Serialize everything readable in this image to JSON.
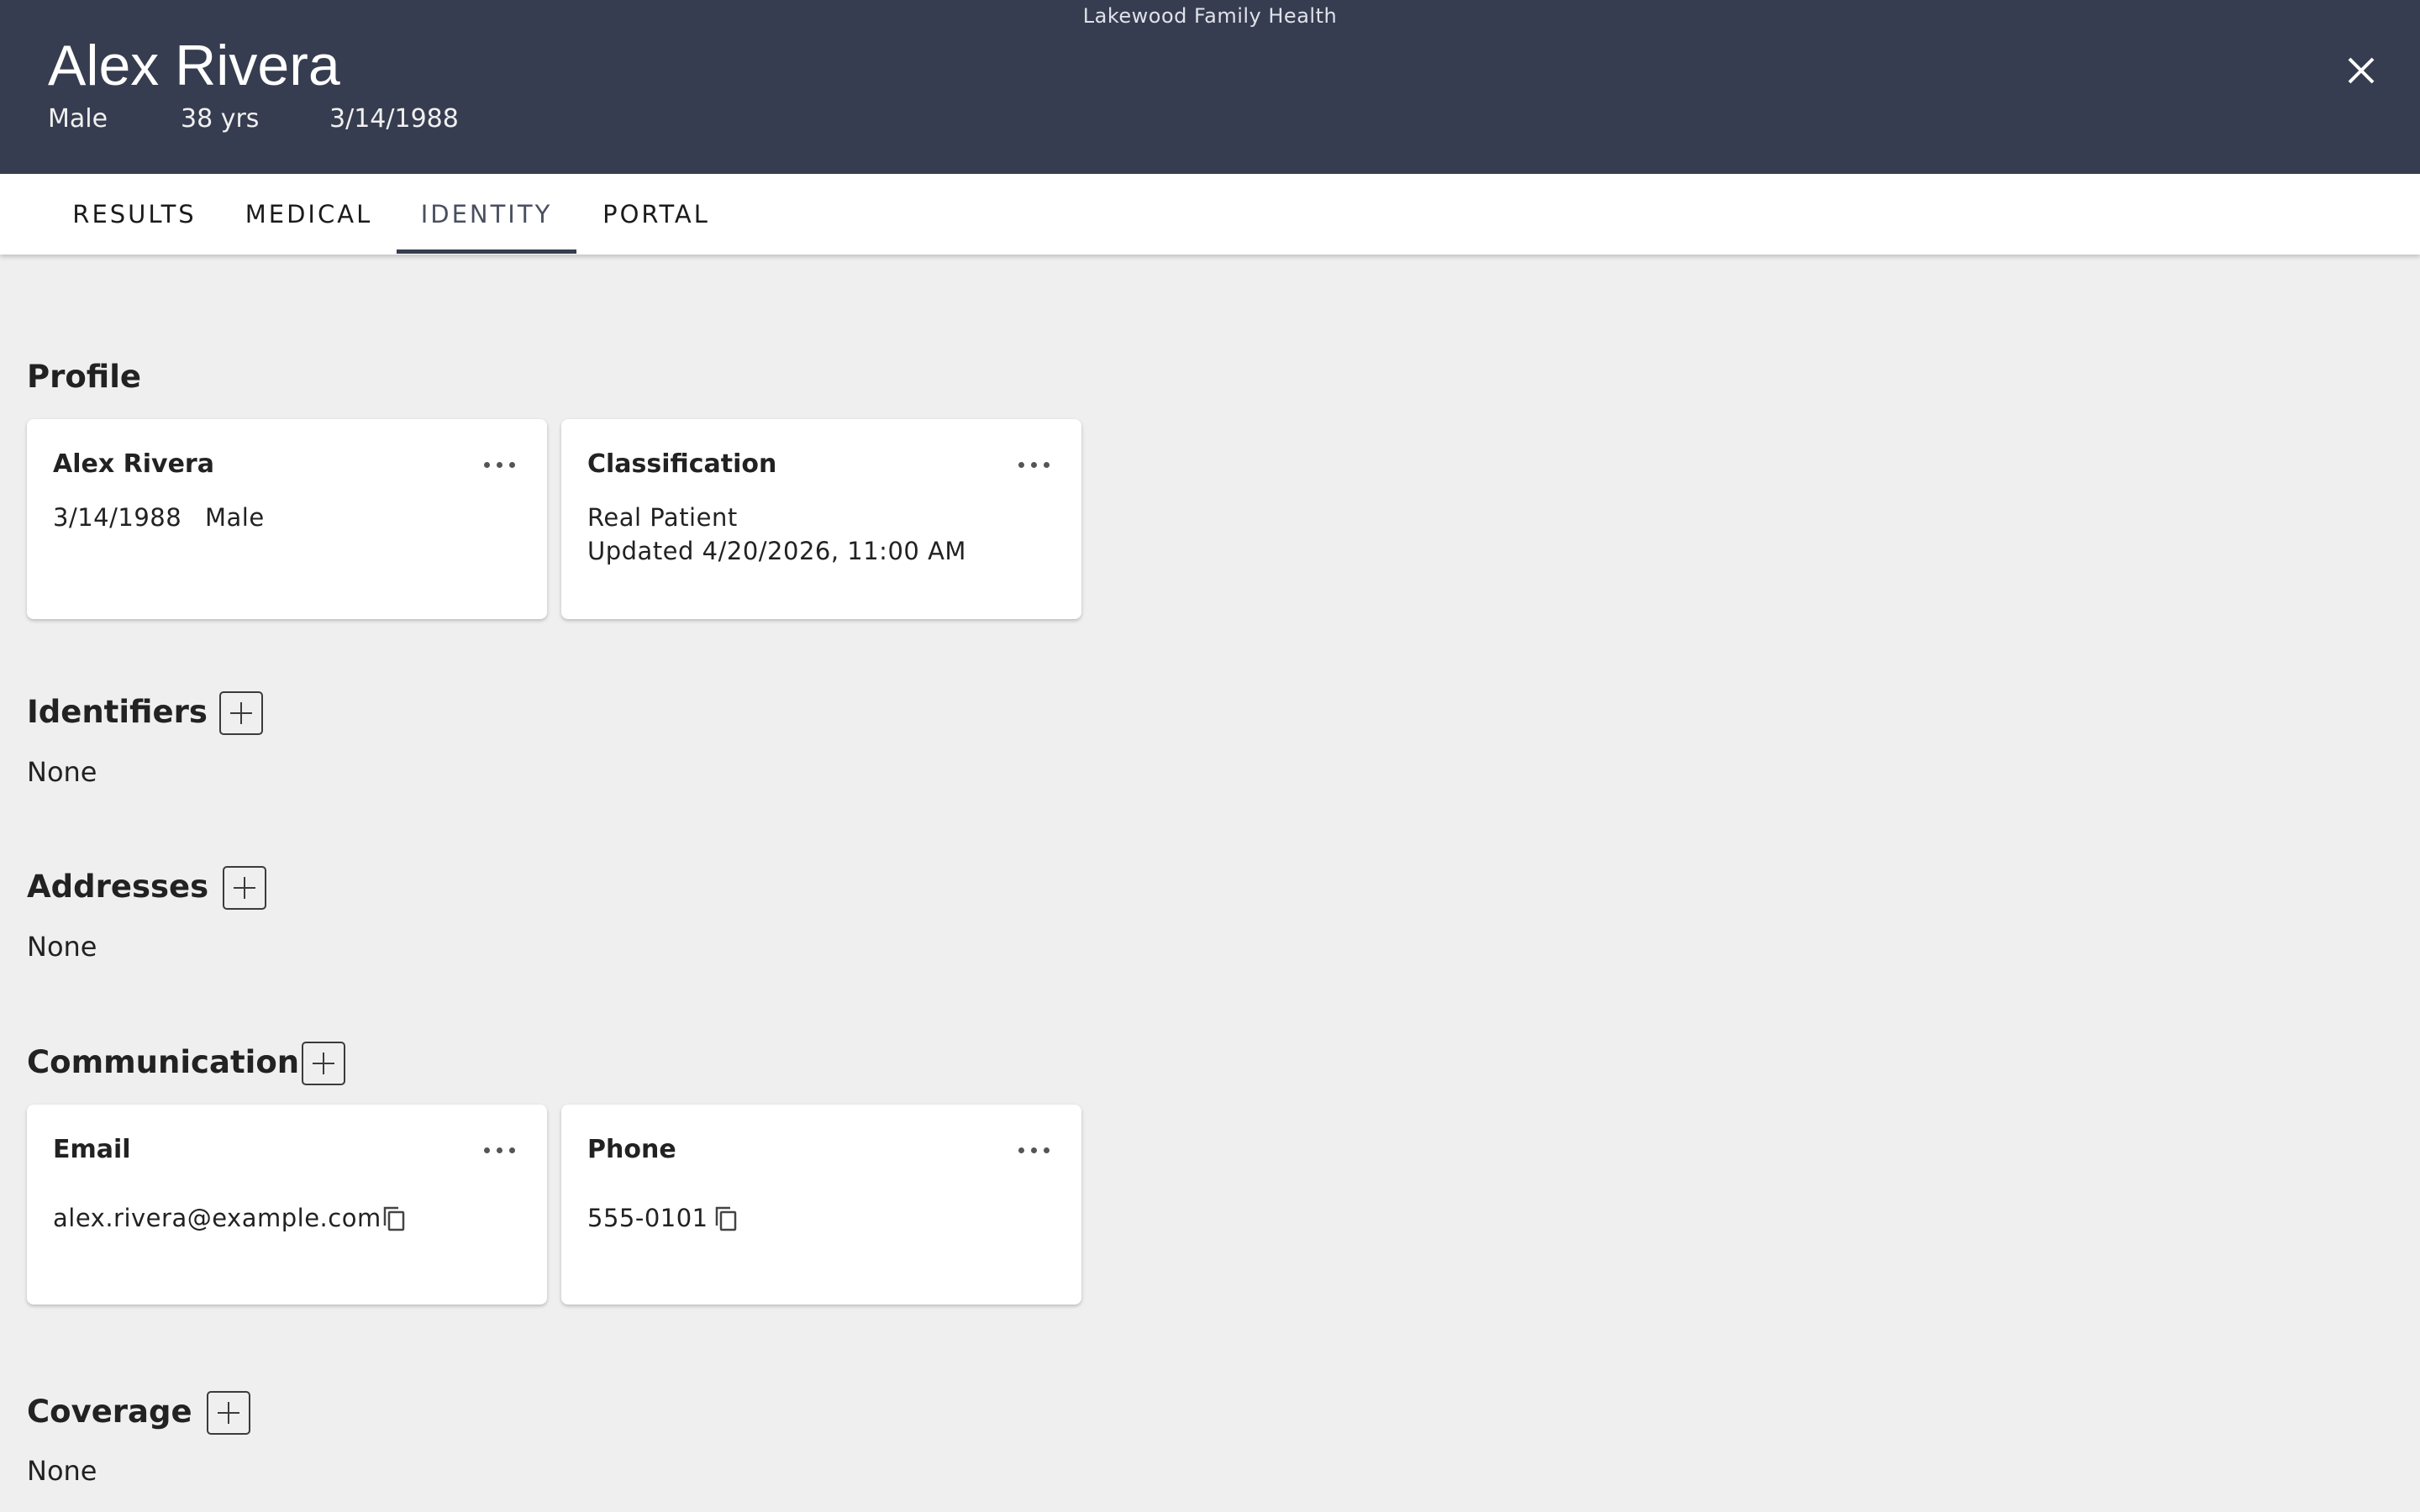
{
  "header": {
    "org": "Lakewood Family Health",
    "name": "Alex Rivera",
    "sex": "Male",
    "age": "38 yrs",
    "dob": "3/14/1988",
    "close_icon": "close-icon"
  },
  "tabs": [
    {
      "label": "RESULTS",
      "active": false
    },
    {
      "label": "MEDICAL",
      "active": false
    },
    {
      "label": "IDENTITY",
      "active": true
    },
    {
      "label": "PORTAL",
      "active": false
    }
  ],
  "profile": {
    "title": "Profile",
    "name_card": {
      "title": "Alex Rivera",
      "dob": "3/14/1988",
      "sex": "Male"
    },
    "classification_card": {
      "title": "Classification",
      "value": "Real Patient",
      "updated": "Updated 4/20/2026, 11:00 AM"
    }
  },
  "identifiers": {
    "title": "Identifiers",
    "empty": "None"
  },
  "addresses": {
    "title": "Addresses",
    "empty": "None"
  },
  "communication": {
    "title": "Communication",
    "email_card": {
      "title": "Email",
      "value": "alex.rivera@example.com"
    },
    "phone_card": {
      "title": "Phone",
      "value": "555-0101"
    }
  },
  "coverage": {
    "title": "Coverage",
    "empty": "None"
  },
  "colors": {
    "header_bg": "#373d50",
    "page_bg": "#efefef",
    "card_bg": "#ffffff"
  }
}
